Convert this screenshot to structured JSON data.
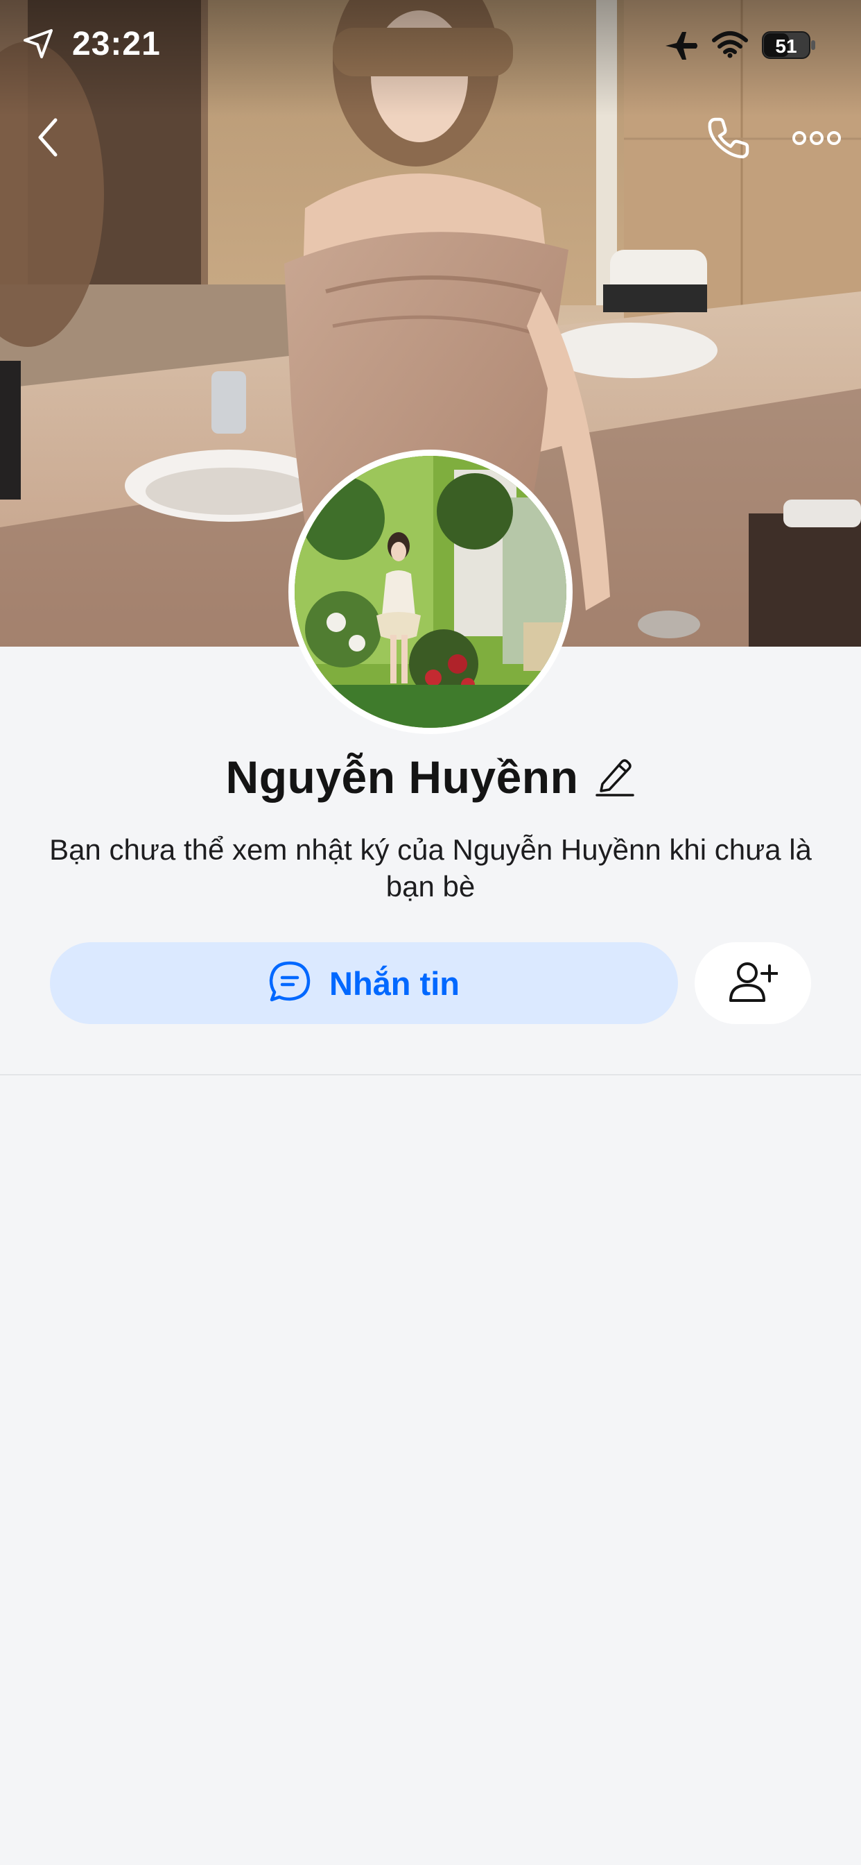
{
  "status_bar": {
    "time": "23:21",
    "battery_level": "51",
    "icons": [
      "location-arrow-icon",
      "airplane-icon",
      "wifi-icon",
      "battery-icon"
    ]
  },
  "nav": {
    "icons": [
      "back-chevron-icon",
      "phone-icon",
      "more-dots-icon"
    ]
  },
  "profile": {
    "name": "Nguyễn Huyềnn",
    "notice": "Bạn chưa thể xem nhật ký của Nguyễn Huyềnn khi chưa là bạn bè"
  },
  "actions": {
    "message_label": "Nhắn tin",
    "accent_color": "#0068ff",
    "message_bg": "#dbe9ff"
  },
  "colors": {
    "background": "#f4f5f7",
    "text": "#141414"
  }
}
